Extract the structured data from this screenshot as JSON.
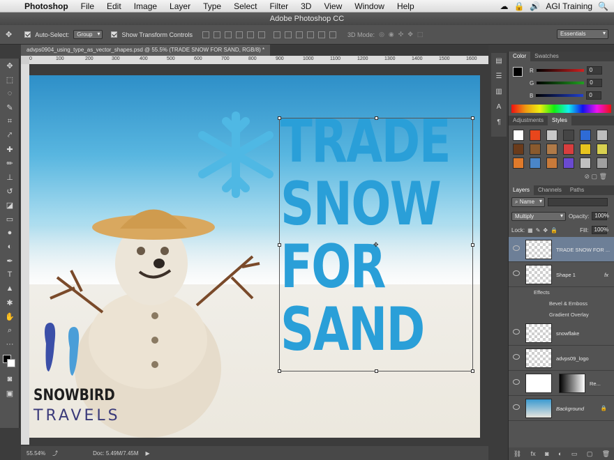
{
  "menubar": {
    "app": "Photoshop",
    "items": [
      "File",
      "Edit",
      "Image",
      "Layer",
      "Type",
      "Select",
      "Filter",
      "3D",
      "View",
      "Window",
      "Help"
    ],
    "user": "AGI Training"
  },
  "window": {
    "title": "Adobe Photoshop CC"
  },
  "options": {
    "auto_select_label": "Auto-Select:",
    "auto_select_value": "Group",
    "transform_label": "Show Transform Controls",
    "mode_label": "3D Mode:",
    "workspace": "Essentials"
  },
  "document": {
    "tab": "advps0904_using_type_as_vector_shapes.psd @ 55.5% (TRADE SNOW FOR SAND, RGB/8) *",
    "ruler_marks": [
      "0",
      "100",
      "150",
      "200",
      "300",
      "400",
      "500",
      "600",
      "700",
      "800",
      "900",
      "1000",
      "1100",
      "1200",
      "1300",
      "1400",
      "1500",
      "1600"
    ],
    "text_lines": [
      "TRADE",
      "SNOW",
      "FOR",
      "SAND"
    ],
    "logo_top": "SNOWBIRD",
    "logo_bottom": "TRAVELS"
  },
  "status": {
    "zoom": "55.54%",
    "doc": "Doc: 5.49M/7.45M"
  },
  "color_panel": {
    "tabs": [
      "Color",
      "Swatches"
    ],
    "channels": [
      {
        "label": "R",
        "value": "0",
        "color": "#d02020"
      },
      {
        "label": "G",
        "value": "0",
        "color": "#20a020"
      },
      {
        "label": "B",
        "value": "0",
        "color": "#2040d0"
      }
    ]
  },
  "styles_panel": {
    "tabs": [
      "Adjustments",
      "Styles"
    ],
    "swatches": [
      "#ffffff",
      "#e8461c",
      "#c9c9c9",
      "#454545",
      "#2e6bd6",
      "#bdbdbd",
      "#6a3b1b",
      "#8a5a2e",
      "#b07a48",
      "#d83e3e",
      "#e8c41e",
      "#d8d050",
      "#e07a2a",
      "#4a86c8",
      "#c87a3a",
      "#6a4ad0",
      "#c0c0c0",
      "#a0a0a0"
    ]
  },
  "layers_panel": {
    "tabs": [
      "Layers",
      "Channels",
      "Paths"
    ],
    "filter": "Name",
    "blend_mode": "Multiply",
    "opacity_label": "Opacity:",
    "opacity": "100%",
    "lock_label": "Lock:",
    "fill_label": "Fill:",
    "fill": "100%",
    "layers": [
      {
        "name": "TRADE SNOW FOR ...",
        "selected": true
      },
      {
        "name": "Shape 1",
        "fx": "fx"
      },
      {
        "name": "snowflake"
      },
      {
        "name": "advps09_logo"
      },
      {
        "name": "Re..."
      },
      {
        "name": "Background"
      }
    ],
    "effects_label": "Effects",
    "effects": [
      "Bevel & Emboss",
      "Gradient Overlay"
    ]
  }
}
